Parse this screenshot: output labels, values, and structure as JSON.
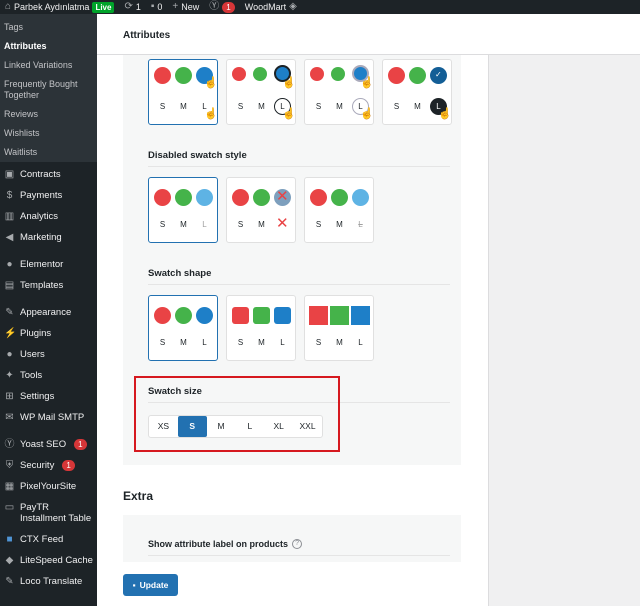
{
  "adminbar": {
    "site_name": "Parbek Aydınlatma",
    "live_badge": "Live",
    "updates_count": "1",
    "comments_count": "0",
    "new_label": "New",
    "yoast_count": "1",
    "woodmart_label": "WoodMart"
  },
  "sidebar": {
    "submenu": [
      "Tags",
      "Attributes",
      "Linked Variations",
      "Frequently Bought Together",
      "Reviews",
      "Wishlists",
      "Waitlists"
    ],
    "menu": [
      {
        "label": "Contracts",
        "icon": "contracts-icon"
      },
      {
        "label": "Payments",
        "icon": "payments-icon"
      },
      {
        "label": "Analytics",
        "icon": "analytics-icon"
      },
      {
        "label": "Marketing",
        "icon": "marketing-icon"
      },
      {
        "label": "Elementor",
        "icon": "elementor-icon"
      },
      {
        "label": "Templates",
        "icon": "templates-icon"
      },
      {
        "label": "Appearance",
        "icon": "appearance-icon"
      },
      {
        "label": "Plugins",
        "icon": "plugins-icon"
      },
      {
        "label": "Users",
        "icon": "users-icon"
      },
      {
        "label": "Tools",
        "icon": "tools-icon"
      },
      {
        "label": "Settings",
        "icon": "settings-icon"
      },
      {
        "label": "WP Mail SMTP",
        "icon": "mail-icon"
      },
      {
        "label": "Yoast SEO",
        "icon": "yoast-icon",
        "count": "1"
      },
      {
        "label": "Security",
        "icon": "security-icon",
        "count": "1"
      },
      {
        "label": "PixelYourSite",
        "icon": "pixel-icon"
      },
      {
        "label": "PayTR Installment Table",
        "icon": "paytr-icon"
      },
      {
        "label": "CTX Feed",
        "icon": "feed-icon"
      },
      {
        "label": "LiteSpeed Cache",
        "icon": "litespeed-icon"
      },
      {
        "label": "Loco Translate",
        "icon": "translate-icon"
      }
    ]
  },
  "header": {
    "title": "Attributes"
  },
  "sections": {
    "disabled_style_title": "Disabled swatch style",
    "shape_title": "Swatch shape",
    "size_title": "Swatch size"
  },
  "swatch_letters": [
    "S",
    "M",
    "L"
  ],
  "sizes": [
    "XS",
    "S",
    "M",
    "L",
    "XL",
    "XXL"
  ],
  "selected_size": "S",
  "extra": {
    "title": "Extra",
    "show_label_option": "Show attribute label on products",
    "help": "?"
  },
  "update_button": "Update",
  "colors": {
    "accent": "#2271b1",
    "highlight": "#d6191f"
  }
}
